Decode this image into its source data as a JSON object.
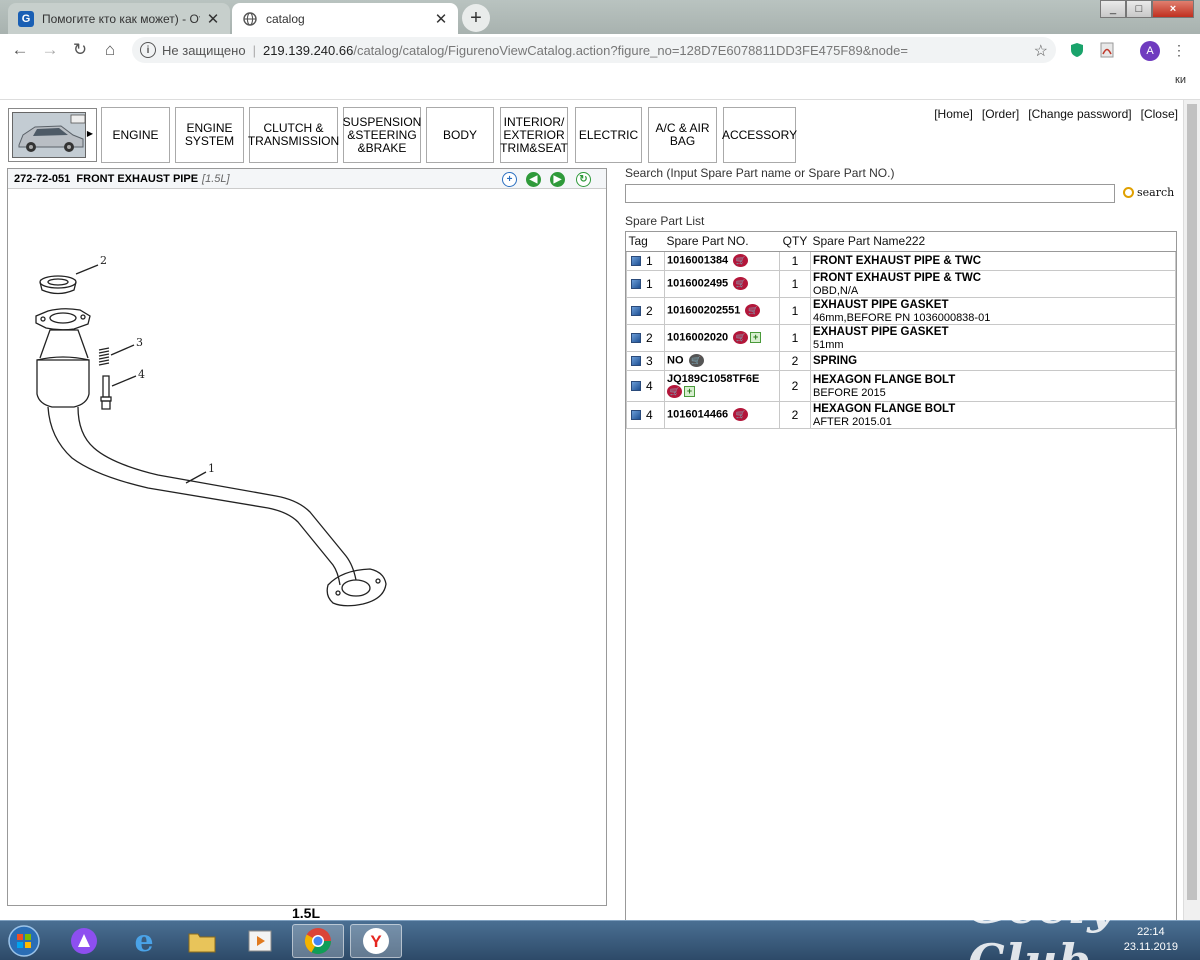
{
  "browser": {
    "tabs": [
      {
        "title": "Помогите кто как может) - Отзы",
        "icon": "G"
      },
      {
        "title": "catalog",
        "icon": "globe-icon"
      }
    ],
    "new_tab": "+",
    "window_buttons": [
      "_",
      "□",
      "×"
    ],
    "address": {
      "security": "Не защищено",
      "host": "219.139.240.66",
      "path": "/catalog/catalog/FigurenoViewCatalog.action?figure_no=128D7E6078811DD3FE475F89&node="
    },
    "profile_initial": "A",
    "bookmarks_right": "ки"
  },
  "catalog": {
    "categories": [
      "ENGINE",
      "ENGINE SYSTEM",
      "CLUTCH & TRANSMISSION",
      "SUSPENSION &STEERING &BRAKE",
      "BODY",
      "INTERIOR/ EXTERIOR TRIM&SEAT",
      "ELECTRIC",
      "A/C & AIR BAG",
      "ACCESSORY"
    ],
    "links": [
      "[Home]",
      "[Order]",
      "[Change password]",
      "[Close]"
    ]
  },
  "figure": {
    "code": "272-72-051",
    "title": "FRONT EXHAUST PIPE",
    "variant": "[1.5L]",
    "callouts": [
      "1",
      "2",
      "3",
      "4"
    ],
    "bottom_label": "1.5L"
  },
  "search": {
    "label": "Search (Input Spare Part name or Spare Part NO.)",
    "value": "",
    "button": "search"
  },
  "parts": {
    "label": "Spare Part List",
    "headers": {
      "tag": "Tag",
      "part_no": "Spare Part NO.",
      "qty": "QTY",
      "name": "Spare Part Name222"
    },
    "rows": [
      {
        "tag": "1",
        "part_no": "1016001384",
        "qty": "1",
        "name": "FRONT EXHAUST PIPE & TWC",
        "note": ""
      },
      {
        "tag": "1",
        "part_no": "1016002495",
        "qty": "1",
        "name": "FRONT EXHAUST PIPE & TWC",
        "note": "OBD,N/A"
      },
      {
        "tag": "2",
        "part_no": "101600202551",
        "qty": "1",
        "name": "EXHAUST PIPE GASKET",
        "note": "46mm,BEFORE PN 1036000838-01"
      },
      {
        "tag": "2",
        "part_no": "1016002020",
        "qty": "1",
        "name": "EXHAUST PIPE GASKET",
        "note": "51mm"
      },
      {
        "tag": "3",
        "part_no": "NO",
        "qty": "2",
        "name": "SPRING",
        "note": ""
      },
      {
        "tag": "4",
        "part_no": "JQ189C1058TF6E",
        "qty": "2",
        "name": "HEXAGON FLANGE BOLT",
        "note": "BEFORE 2015"
      },
      {
        "tag": "4",
        "part_no": "1016014466",
        "qty": "2",
        "name": "HEXAGON FLANGE BOLT",
        "note": "AFTER 2015.01"
      }
    ]
  },
  "taskbar": {
    "time": "22:14",
    "date": "23.11.2019",
    "watermark": "Geely Club"
  }
}
